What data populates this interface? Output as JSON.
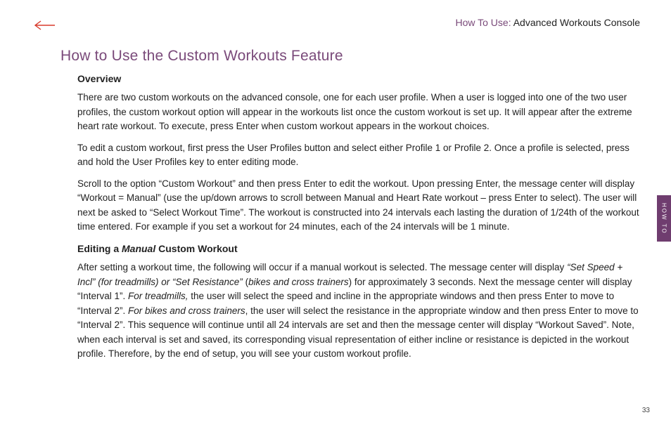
{
  "header": {
    "breadcrumb_prefix": "How To Use:",
    "breadcrumb_current": " Advanced Workouts Console"
  },
  "title": "How to Use the Custom Workouts Feature",
  "sections": {
    "overview_heading": "Overview",
    "overview_p1": "There are two custom workouts on the advanced console, one for each user profile. When a user is logged into one of the two user profiles, the custom workout option will appear in the workouts list once the custom workout is set up. It will appear after the extreme heart rate workout. To execute, press Enter when custom workout appears in the workout choices.",
    "overview_p2": "To edit a custom workout, first press the User Profiles button and select either Profile 1 or Profile 2. Once a profile is selected, press and hold the User Profiles key to enter editing mode.",
    "overview_p3": "Scroll to the option “Custom Workout” and then press Enter to edit the workout.  Upon pressing Enter, the message center will display “Workout = Manual” (use the up/down arrows to scroll between Manual and Heart Rate workout – press Enter to select).  The user will next be asked to “Select Workout Time”. The workout is constructed into 24 intervals each lasting the duration of 1/24th of the workout time entered.  For example if you set a workout for 24 minutes, each of the 24 intervals will be 1 minute.",
    "editing_heading_pre": "Editing a ",
    "editing_heading_em": "Manual",
    "editing_heading_post": " Custom Workout",
    "editing_p1_a": "After setting a workout time, the following will occur if a manual workout is selected. The message center will display ",
    "editing_p1_b": "“Set Speed + Incl” (for treadmills) or “Set Resistance”",
    "editing_p1_c": " (",
    "editing_p1_d": "bikes and cross trainers",
    "editing_p1_e": ") for approximately 3 seconds. Next the message center will display “Interval 1”. ",
    "editing_p1_f": "For treadmills,",
    "editing_p1_g": " the user will select the speed and incline in the appropriate windows and then press Enter to move to “Interval 2”. ",
    "editing_p1_h": "For bikes and cross trainers",
    "editing_p1_i": ", the user will select the resistance in the appropriate window and then press Enter to move to “Interval 2”. This sequence will continue until all 24 intervals are set and then the message center will display “Workout Saved”. Note, when each interval is set and saved, its corresponding visual representation of either incline or resistance is depicted in the workout profile. Therefore, by the end of setup, you will see your custom workout profile."
  },
  "side_tab": "HOW TO",
  "page_number": "33",
  "colors": {
    "accent": "#7a4a7a",
    "tab": "#6f3d6f",
    "arrow": "#d83a2b"
  }
}
